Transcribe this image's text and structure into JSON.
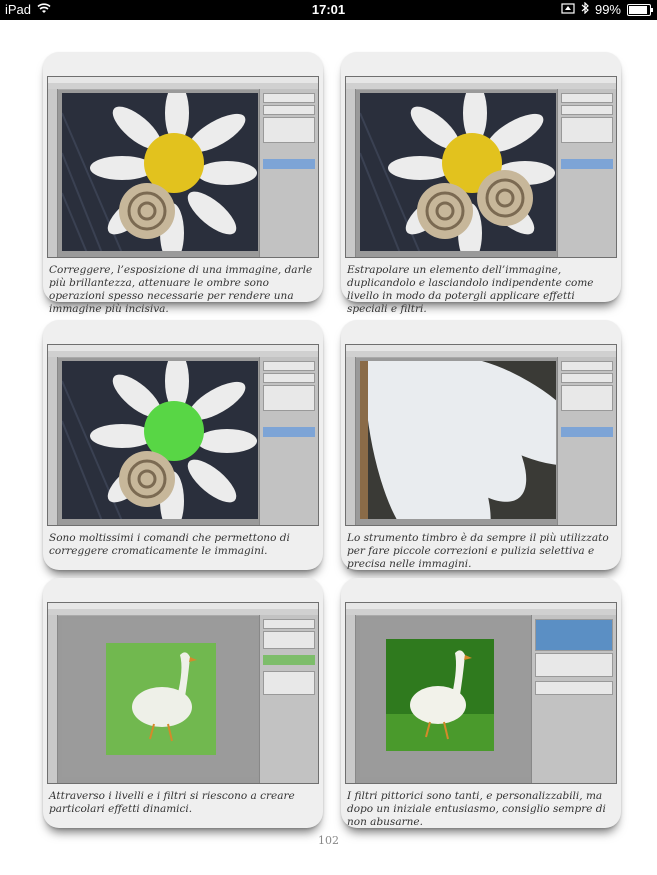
{
  "status_bar": {
    "device": "iPad",
    "time": "17:01",
    "battery": "99%",
    "battery_level": 0.99
  },
  "cards": [
    {
      "caption": "Correggere, l’esposizione di una immagine, darle più brillantezza, attenuare le ombre sono operazioni spesso necessarie per rendere una immagine più incisiva.",
      "image": "daisy-with-snail"
    },
    {
      "caption": "Estrapolare un elemento dell’immagine, duplicandolo e lasciandolo indipendente come livello in modo da potergli applicare effetti speciali e filtri.",
      "image": "daisy-with-two-snails"
    },
    {
      "caption": "Sono moltissimi i comandi che permettono di correggere cromaticamente le immagini.",
      "image": "daisy-green-center"
    },
    {
      "caption": "Lo strumento timbro è da sempre il più utilizzato per fare piccole correzioni e pulizia selettiva e precisa nelle immagini.",
      "image": "petals-closeup"
    },
    {
      "caption": "Attraverso i livelli e i filtri si riescono a creare particolari effetti dinamici.",
      "image": "goose-blurred"
    },
    {
      "caption": "I filtri pittorici sono tanti, e personalizzabili, ma dopo un iniziale entusiasmo, consiglio sempre di non abusarne.",
      "image": "goose-filtered"
    }
  ],
  "page_number": "102",
  "colors": {
    "card_bg": "#efefef",
    "status_bar": "#000000",
    "caption": "#333333"
  }
}
